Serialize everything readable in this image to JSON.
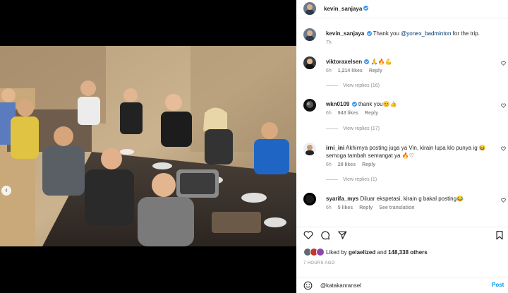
{
  "post": {
    "author": "kevin_sanjaya",
    "caption_prefix": "Thank you ",
    "caption_mention": "@yonex_badminton",
    "caption_suffix": " for the trip.",
    "caption_time": "7h"
  },
  "comments": [
    {
      "user": "viktoraxelsen",
      "verified": true,
      "text": "🙏🔥💪",
      "time": "6h",
      "likes": "1,214 likes",
      "reply": "Reply",
      "view_replies": "View replies (16)"
    },
    {
      "user": "wkn0109",
      "verified": true,
      "text": "thank you😊👍",
      "time": "6h",
      "likes": "943 likes",
      "reply": "Reply",
      "view_replies": "View replies (17)"
    },
    {
      "user": "irni_ini",
      "verified": false,
      "text": "Akhirnya posting juga ya Vin, kirain lupa klo punya ig 😆 semoga tambah semangat ya 🔥♡",
      "time": "6h",
      "likes": "28 likes",
      "reply": "Reply",
      "view_replies": "View replies (1)"
    },
    {
      "user": "syarifa_mys",
      "verified": false,
      "text": "Diluar ekspetasi, kirain g bakal posting😂",
      "time": "6h",
      "likes": "5 likes",
      "reply": "Reply",
      "extra": "See translation"
    }
  ],
  "likes": {
    "prefix": "Liked by ",
    "user": "gelaelized",
    "mid": " and ",
    "count": "148,338 others"
  },
  "time_ago": "7 HOURS AGO",
  "add_comment": {
    "value": "@katakanransel",
    "post_label": "Post"
  },
  "carousel": {
    "total": 10,
    "active_index": 9
  },
  "colors": {
    "accent": "#0095f6",
    "verified": "#3897f0",
    "muted": "#8e8e8e"
  },
  "icons": [
    "heart-icon",
    "comment-icon",
    "share-icon",
    "save-icon",
    "emoji-icon",
    "verified-icon",
    "chevron-left-icon"
  ]
}
